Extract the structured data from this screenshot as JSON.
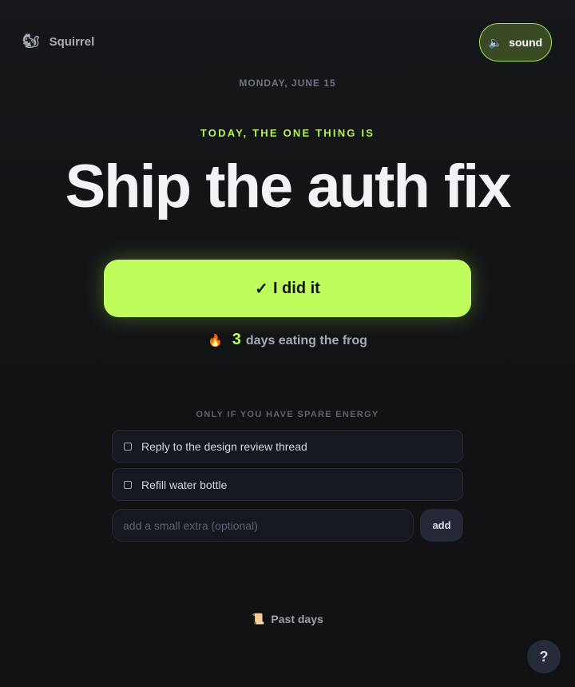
{
  "brand": {
    "icon": "squirrel-icon",
    "icon_glyph": "🐿",
    "name": "Squirrel"
  },
  "sound_toggle": {
    "icon": "speaker-icon",
    "icon_glyph": "🔈",
    "label": "sound",
    "active": true
  },
  "date": "MONDAY, JUNE 15",
  "kicker": "TODAY, THE ONE THING IS",
  "headline": "Ship the auth fix",
  "done_button": {
    "check": "✓",
    "label": "I did it"
  },
  "streak": {
    "icon": "fire-icon",
    "icon_glyph": "🔥",
    "count": "3",
    "text": "days eating the frog"
  },
  "extras": {
    "label": "ONLY IF YOU HAVE SPARE ENERGY",
    "items": [
      {
        "text": "Reply to the design review thread",
        "checked": false
      },
      {
        "text": "Refill water bottle",
        "checked": false
      }
    ],
    "input": {
      "value": "",
      "placeholder": "add a small extra (optional)"
    },
    "add_label": "add"
  },
  "past_days": {
    "icon": "scroll-icon",
    "icon_glyph": "📜",
    "label": "Past days"
  },
  "help_label": "?",
  "colors": {
    "accent": "#bffd5c",
    "background": "#121416",
    "text": "#f2f3f6"
  }
}
